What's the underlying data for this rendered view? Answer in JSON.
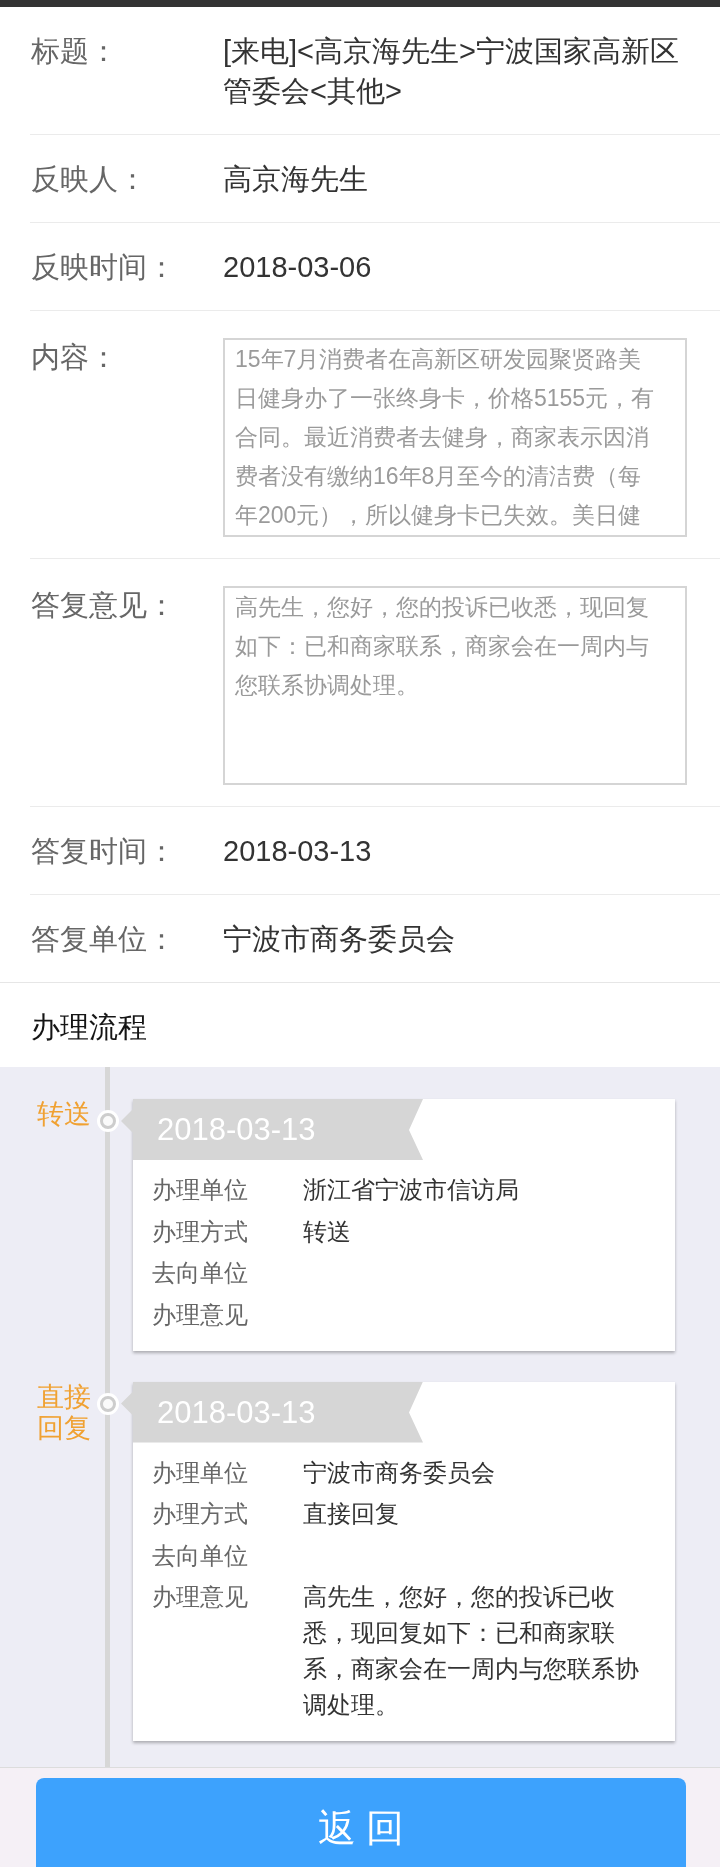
{
  "fields": [
    {
      "kind": "text",
      "label": "标题：",
      "value": "[来电]<高京海先生>宁波国家高新区管委会<其他>"
    },
    {
      "kind": "text",
      "label": "反映人：",
      "value": "高京海先生"
    },
    {
      "kind": "text",
      "label": "反映时间：",
      "value": "2018-03-06"
    },
    {
      "kind": "textbox",
      "label": "内容：",
      "value": "15年7月消费者在高新区研发园聚贤路美日健身办了一张终身卡，价格5155元，有合同。最近消费者去健身，商家表示因消费者没有缴纳16年8月至今的清洁费（每年200元），所以健身卡已失效。美日健"
    },
    {
      "kind": "textbox",
      "label": "答复意见：",
      "value": "高先生，您好，您的投诉已收悉，现回复如下：已和商家联系，商家会在一周内与您联系协调处理。"
    },
    {
      "kind": "text",
      "label": "答复时间：",
      "value": "2018-03-13"
    },
    {
      "kind": "text",
      "label": "答复单位：",
      "value": "宁波市商务委员会"
    }
  ],
  "process": {
    "title": "办理流程",
    "steps": [
      {
        "action": "转送",
        "date": "2018-03-13",
        "details": [
          {
            "label": "办理单位",
            "value": "浙江省宁波市信访局"
          },
          {
            "label": "办理方式",
            "value": "转送"
          },
          {
            "label": "去向单位"
          },
          {
            "label": "办理意见"
          }
        ]
      },
      {
        "action": "直接回复",
        "date": "2018-03-13",
        "details": [
          {
            "label": "办理单位",
            "value": "宁波市商务委员会"
          },
          {
            "label": "办理方式",
            "value": "直接回复"
          },
          {
            "label": "去向单位"
          },
          {
            "label": "办理意见",
            "value": "高先生，您好，您的投诉已收悉，现回复如下：已和商家联系，商家会在一周内与您联系协调处理。"
          }
        ]
      }
    ]
  },
  "back_button": {
    "label": "返 回"
  }
}
